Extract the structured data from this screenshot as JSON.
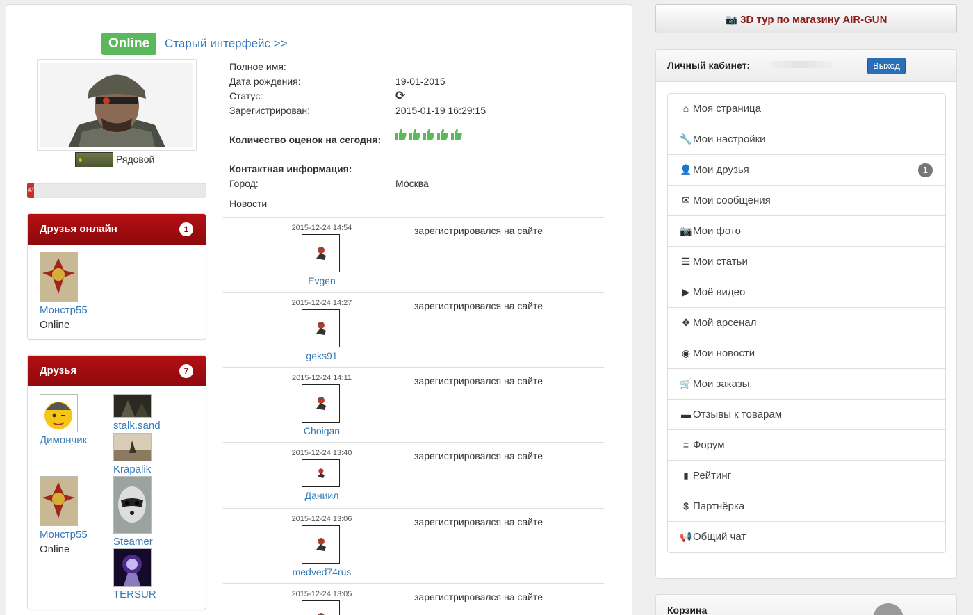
{
  "profile": {
    "status_badge": "Online",
    "old_interface_link": "Старый интерфейс >>",
    "rank_label": "Рядовой",
    "progress_percent": 4,
    "progress_text": "4%",
    "fields": {
      "full_name_label": "Полное имя:",
      "full_name_value": "",
      "birth_label": "Дата рождения:",
      "birth_value": "19-01-2015",
      "status_label": "Статус:",
      "registered_label": "Зарегистрирован:",
      "registered_value": "2015-01-19 16:29:15",
      "ratings_label": "Количество оценок на сегодня:",
      "ratings_count": 5,
      "contact_label": "Контактная информация:",
      "city_label": "Город:",
      "city_value": "Москва",
      "news_label": "Новости"
    }
  },
  "friends_online": {
    "title": "Друзья онлайн",
    "count": "1",
    "items": [
      {
        "name": "Монстр55",
        "status": "Online"
      }
    ]
  },
  "friends": {
    "title": "Друзья",
    "count": "7",
    "items": [
      {
        "name": "Димончик",
        "status": ""
      },
      {
        "name": "stalk.sand",
        "status": ""
      },
      {
        "name": "Krapalik",
        "status": ""
      },
      {
        "name": "Монстр55",
        "status": "Online"
      },
      {
        "name": "Steamer",
        "status": ""
      },
      {
        "name": "TERSUR",
        "status": ""
      }
    ]
  },
  "news_feed": [
    {
      "time": "2015-12-24 14:54",
      "user": "Evgen",
      "text": "зарегистрировался на сайте"
    },
    {
      "time": "2015-12-24 14:27",
      "user": "geks91",
      "text": "зарегистрировался на сайте"
    },
    {
      "time": "2015-12-24 14:11",
      "user": "Choigan",
      "text": "зарегистрировался на сайте"
    },
    {
      "time": "2015-12-24 13:40",
      "user": "Даниил",
      "text": "зарегистрировался на сайте"
    },
    {
      "time": "2015-12-24 13:06",
      "user": "medved74rus",
      "text": "зарегистрировался на сайте"
    },
    {
      "time": "2015-12-24 13:05",
      "user": "",
      "text": "зарегистрировался на сайте"
    }
  ],
  "sidebar": {
    "tour_button": "3D тур по магазину AIR-GUN",
    "cabinet_title": "Личный кабинет:",
    "logout_label": "Выход",
    "menu": [
      {
        "label": "Моя страница",
        "icon": "home-icon",
        "glyph": "⌂"
      },
      {
        "label": "Мои настройки",
        "icon": "wrench-icon",
        "glyph": "🔧"
      },
      {
        "label": "Мои друзья",
        "icon": "user-icon",
        "glyph": "👤",
        "count": "1"
      },
      {
        "label": "Мои сообщения",
        "icon": "envelope-icon",
        "glyph": "✉"
      },
      {
        "label": "Мои фото",
        "icon": "camera-icon",
        "glyph": "📷"
      },
      {
        "label": "Мои статьи",
        "icon": "list-icon",
        "glyph": "☰"
      },
      {
        "label": "Моё видео",
        "icon": "video-icon",
        "glyph": "▶"
      },
      {
        "label": "Мой арсенал",
        "icon": "move-icon",
        "glyph": "✥"
      },
      {
        "label": "Мои новости",
        "icon": "globe-icon",
        "glyph": "◉"
      },
      {
        "label": "Мои заказы",
        "icon": "cart-icon",
        "glyph": "🛒"
      },
      {
        "label": "Отзывы к товарам",
        "icon": "comment-icon",
        "glyph": "▬"
      },
      {
        "label": "Форум",
        "icon": "align-justify-icon",
        "glyph": "≡"
      },
      {
        "label": "Рейтинг",
        "icon": "stats-icon",
        "glyph": "▮"
      },
      {
        "label": "Партнёрка",
        "icon": "dollar-icon",
        "glyph": "$"
      },
      {
        "label": "Общий чат",
        "icon": "bullhorn-icon",
        "glyph": "📢"
      }
    ],
    "cart_title": "Корзина"
  }
}
